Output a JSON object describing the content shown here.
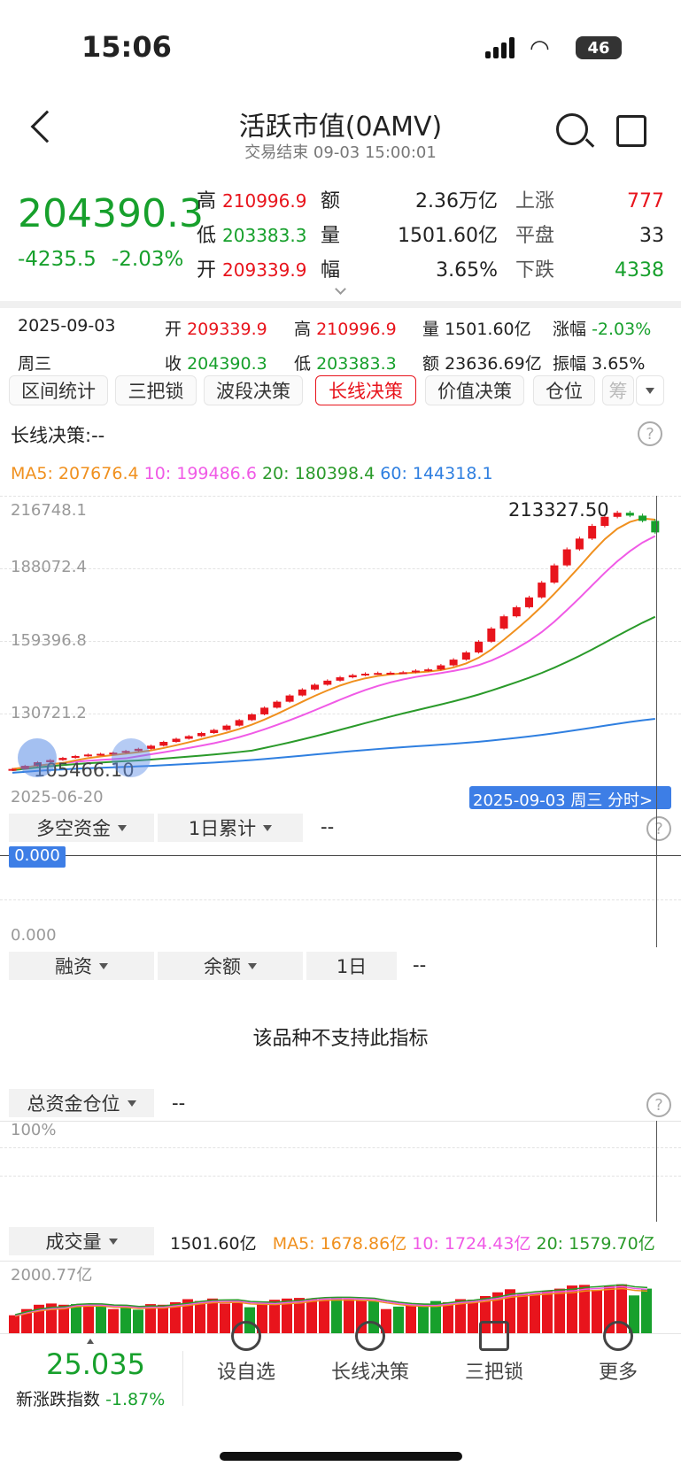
{
  "status_bar": {
    "time": "15:06",
    "battery": "46"
  },
  "header": {
    "title": "活跃市值(0AMV)",
    "subtitle": "交易结束 09-03 15:00:01"
  },
  "quote": {
    "price": "204390.3",
    "change": "-4235.5",
    "change_pct": "-2.03%",
    "high_label": "高",
    "high": "210996.9",
    "low_label": "低",
    "low": "203383.3",
    "open_label": "开",
    "open": "209339.9",
    "amount_label": "额",
    "amount": "2.36万亿",
    "volume_label": "量",
    "volume": "1501.60亿",
    "range_label": "幅",
    "range": "3.65%",
    "up_label": "上涨",
    "up": "777",
    "flat_label": "平盘",
    "flat": "33",
    "down_label": "下跌",
    "down": "4338"
  },
  "day_info": {
    "date": "2025-09-03",
    "weekday": "周三",
    "open_label": "开",
    "open": "209339.9",
    "high_label": "高",
    "high": "210996.9",
    "vol_label": "量",
    "vol": "1501.60亿",
    "chg_label": "涨幅",
    "chg": "-2.03%",
    "close_label": "收",
    "close": "204390.3",
    "low_label": "低",
    "low": "203383.3",
    "amt_label": "额",
    "amt": "23636.69亿",
    "amp_label": "振幅",
    "amp": "3.65%"
  },
  "tabs": [
    "区间统计",
    "三把锁",
    "波段决策",
    "长线决策",
    "价值决策",
    "仓位",
    "筹"
  ],
  "decision": {
    "label": "长线决策:--"
  },
  "ma": {
    "ma5": "MA5: 207676.4",
    "ma10": "10: 199486.6",
    "ma20": "20: 180398.4",
    "ma60": "60: 144318.1",
    "c5": "#f0901e",
    "c10": "#f05ae6",
    "c20": "#2a9a2a",
    "c60": "#2f7fe0"
  },
  "kline": {
    "y_labels": [
      "216748.1",
      "188072.4",
      "159396.8",
      "130721.2"
    ],
    "max_tag": "213327.50",
    "min_tag": "105466.10",
    "start_date": "2025-06-20",
    "end_tag": "2025-09-03 周三 分时>"
  },
  "chart_data": {
    "type": "candlestick",
    "y_range": [
      102000,
      216748.1
    ],
    "closes": [
      105466,
      106800,
      108300,
      109200,
      110100,
      110900,
      111500,
      111800,
      112300,
      113000,
      113900,
      115200,
      116800,
      118100,
      119200,
      120500,
      121800,
      123600,
      125900,
      128300,
      131100,
      133600,
      136200,
      138700,
      140700,
      142400,
      143800,
      144700,
      145300,
      145600,
      145700,
      145900,
      146600,
      147100,
      148800,
      151200,
      154200,
      158700,
      164200,
      169300,
      173100,
      177200,
      183400,
      190600,
      197300,
      201800,
      207100,
      210900,
      212600,
      211400,
      209200,
      204390
    ]
  },
  "flow": {
    "select1": "多空资金",
    "select2": "1日累计",
    "value": "--",
    "badge": "0.000",
    "bottom": "0.000"
  },
  "margin": {
    "select1": "融资",
    "select2": "余额",
    "select3": "1日",
    "value": "--",
    "message": "该品种不支持此指标"
  },
  "position": {
    "select": "总资金仓位",
    "value": "--",
    "top": "100%"
  },
  "volume": {
    "select": "成交量",
    "value": "1501.60亿",
    "ma5": "MA5: 1678.86亿",
    "ma10": "10: 1724.43亿",
    "ma20": "20: 1579.70亿",
    "top": "2000.77亿",
    "bars": [
      0.29,
      0.39,
      0.46,
      0.48,
      0.46,
      0.47,
      0.44,
      0.45,
      0.39,
      0.44,
      0.38,
      0.47,
      0.46,
      0.5,
      0.55,
      0.52,
      0.56,
      0.48,
      0.51,
      0.42,
      0.48,
      0.54,
      0.56,
      0.57,
      0.56,
      0.56,
      0.57,
      0.56,
      0.53,
      0.52,
      0.39,
      0.43,
      0.46,
      0.48,
      0.52,
      0.5,
      0.55,
      0.54,
      0.6,
      0.66,
      0.71,
      0.64,
      0.64,
      0.68,
      0.72,
      0.77,
      0.78,
      0.7,
      0.76,
      0.79,
      0.61,
      0.72
    ],
    "up": [
      1,
      1,
      1,
      1,
      1,
      0,
      1,
      0,
      1,
      0,
      0,
      1,
      1,
      1,
      1,
      1,
      1,
      1,
      1,
      0,
      1,
      1,
      1,
      1,
      1,
      1,
      0,
      1,
      1,
      0,
      1,
      0,
      1,
      0,
      0,
      1,
      1,
      1,
      1,
      1,
      1,
      1,
      1,
      1,
      1,
      1,
      1,
      1,
      1,
      1,
      0,
      0
    ]
  },
  "bottom_nav": {
    "index_value": "25.035",
    "index_label": "新涨跌指数",
    "index_chg": "-1.87%",
    "items": [
      "设自选",
      "长线决策",
      "三把锁",
      "更多"
    ]
  }
}
